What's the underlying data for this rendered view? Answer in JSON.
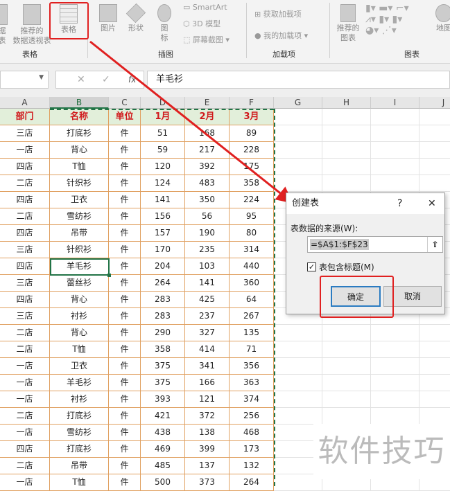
{
  "ribbon": {
    "groups": [
      {
        "label": "表格"
      },
      {
        "label": "插图"
      },
      {
        "label": "加载项"
      },
      {
        "label": "图表"
      }
    ],
    "pivot_partial": "据\n表",
    "recommended_pivot": "推荐的\n数据透视表",
    "table": "表格",
    "picture": "图片",
    "shapes": "形状",
    "icons": "图\n标",
    "smartart": "SmartArt",
    "model3d": "3D 模型",
    "screenshot": "屏幕截图 ▾",
    "get_addins": "获取加载项",
    "my_addins": "我的加载项 ▾",
    "recommended_charts": "推荐的\n图表",
    "maps": "地图"
  },
  "formula_bar": {
    "cancel": "✕",
    "enter": "✓",
    "fx": "fx",
    "value": "羊毛衫"
  },
  "columns": [
    "A",
    "B",
    "C",
    "D",
    "E",
    "F",
    "G",
    "H",
    "I",
    "J"
  ],
  "table": {
    "headers": [
      "部门",
      "名称",
      "单位",
      "1月",
      "2月",
      "3月"
    ],
    "rows": [
      [
        "三店",
        "打底衫",
        "件",
        "51",
        "168",
        "89"
      ],
      [
        "一店",
        "背心",
        "件",
        "59",
        "217",
        "228"
      ],
      [
        "四店",
        "T恤",
        "件",
        "120",
        "392",
        "175"
      ],
      [
        "二店",
        "针织衫",
        "件",
        "124",
        "483",
        "358"
      ],
      [
        "四店",
        "卫衣",
        "件",
        "141",
        "350",
        "224"
      ],
      [
        "二店",
        "雪纺衫",
        "件",
        "156",
        "56",
        "95"
      ],
      [
        "四店",
        "吊带",
        "件",
        "157",
        "190",
        "80"
      ],
      [
        "三店",
        "针织衫",
        "件",
        "170",
        "235",
        "314"
      ],
      [
        "四店",
        "羊毛衫",
        "件",
        "204",
        "103",
        "440"
      ],
      [
        "三店",
        "蕾丝衫",
        "件",
        "264",
        "141",
        "360"
      ],
      [
        "四店",
        "背心",
        "件",
        "283",
        "425",
        "64"
      ],
      [
        "三店",
        "衬衫",
        "件",
        "283",
        "237",
        "267"
      ],
      [
        "二店",
        "背心",
        "件",
        "290",
        "327",
        "135"
      ],
      [
        "二店",
        "T恤",
        "件",
        "358",
        "414",
        "71"
      ],
      [
        "一店",
        "卫衣",
        "件",
        "375",
        "341",
        "356"
      ],
      [
        "一店",
        "羊毛衫",
        "件",
        "375",
        "166",
        "363"
      ],
      [
        "一店",
        "衬衫",
        "件",
        "393",
        "121",
        "374"
      ],
      [
        "二店",
        "打底衫",
        "件",
        "421",
        "372",
        "256"
      ],
      [
        "一店",
        "雪纺衫",
        "件",
        "438",
        "138",
        "468"
      ],
      [
        "四店",
        "打底衫",
        "件",
        "469",
        "399",
        "173"
      ],
      [
        "二店",
        "吊带",
        "件",
        "485",
        "137",
        "132"
      ],
      [
        "一店",
        "T恤",
        "件",
        "500",
        "373",
        "264"
      ]
    ]
  },
  "dialog": {
    "title": "创建表",
    "help": "?",
    "close": "✕",
    "source_label": "表数据的来源(W):",
    "source_value": "=$A$1:$F$23",
    "has_headers_label": "表包含标题(M)",
    "has_headers": true,
    "ok": "确定",
    "cancel": "取消"
  },
  "watermark": "软件技巧",
  "colors": {
    "annotation": "#e02020",
    "header_bg": "#e2efda",
    "header_text": "#d0181b",
    "border": "#e0a060",
    "selection": "#217346"
  }
}
